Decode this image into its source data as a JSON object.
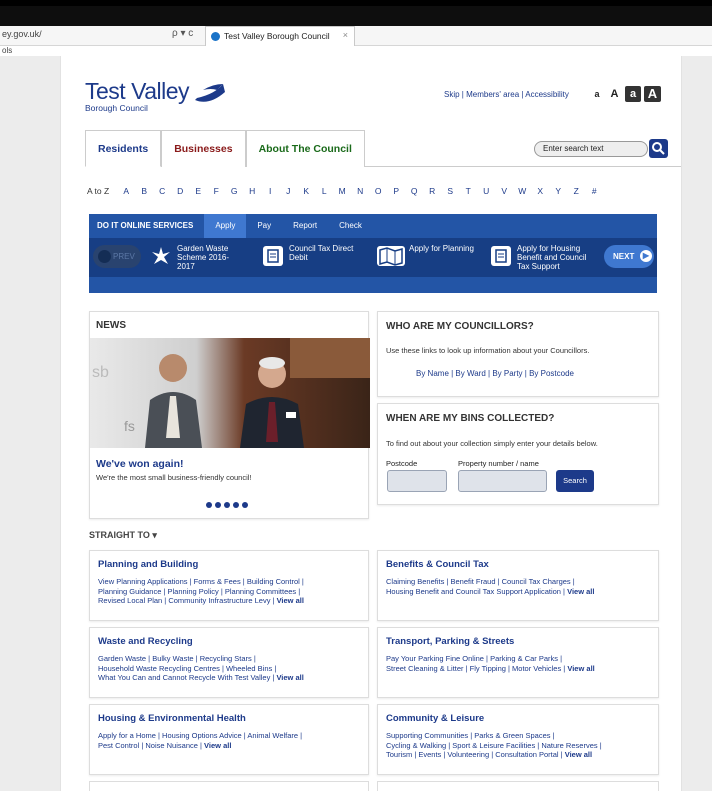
{
  "browser": {
    "url": "ey.gov.uk/",
    "tab_title": "Test Valley Borough Council",
    "tab_close": "×",
    "search_glyph": "ρ ▾ c",
    "tools": "ols"
  },
  "header": {
    "logo_title": "Test Valley",
    "logo_subtitle": "Borough Council",
    "top_links": "Skip | Members' area | Accessibility",
    "text_sizes": [
      "a",
      "A",
      "a",
      "A"
    ]
  },
  "nav": {
    "tabs": [
      "Residents",
      "Businesses",
      "About The Council"
    ],
    "search_placeholder": "Enter search text"
  },
  "az": {
    "label": "A to Z",
    "letters": [
      "A",
      "B",
      "C",
      "D",
      "E",
      "F",
      "G",
      "H",
      "I",
      "J",
      "K",
      "L",
      "M",
      "N",
      "O",
      "P",
      "Q",
      "R",
      "S",
      "T",
      "U",
      "V",
      "W",
      "X",
      "Y",
      "Z",
      "#"
    ]
  },
  "services": {
    "heading": "DO IT ONLINE SERVICES",
    "tabs": [
      "Apply",
      "Pay",
      "Report",
      "Check"
    ],
    "prev": "PREV",
    "next": "NEXT",
    "items": [
      {
        "l1": "Garden Waste",
        "l2": "Scheme 2016-",
        "l3": "2017",
        "icon": "leaf-icon"
      },
      {
        "l1": "Council Tax Direct",
        "l2": "Debit",
        "l3": "",
        "icon": "document-icon"
      },
      {
        "l1": "Apply for Planning",
        "l2": "",
        "l3": "",
        "icon": "map-icon"
      },
      {
        "l1": "Apply for Housing",
        "l2": "Benefit and Council",
        "l3": "Tax Support",
        "icon": "document-icon"
      }
    ]
  },
  "news": {
    "heading": "NEWS",
    "title": "We've won again!",
    "subtitle": "We're the most small business-friendly council!",
    "photo_text": "sb",
    "photo_text2": "fs"
  },
  "councillors": {
    "heading": "WHO ARE MY COUNCILLORS?",
    "description": "Use these links to look up information about your Councillors.",
    "links": "By Name  |  By Ward  |  By Party  |  By Postcode"
  },
  "bins": {
    "heading": "WHEN ARE MY BINS COLLECTED?",
    "description": "To find out about your collection simply enter your details below.",
    "postcode_label": "Postcode",
    "property_label": "Property number / name",
    "search_button": "Search"
  },
  "straight_to": "STRAIGHT TO ▾",
  "sections": {
    "planning": {
      "title": "Planning and Building",
      "lines": [
        "View Planning Applications | Forms & Fees | Building Control |",
        "Planning Guidance | Planning Policy | Planning Committees |",
        "Revised Local Plan | Community Infrastructure Levy | "
      ],
      "view_all": "View all"
    },
    "benefits": {
      "title": "Benefits & Council Tax",
      "lines": [
        "Claiming Benefits | Benefit Fraud | Council Tax Charges |",
        "Housing Benefit and Council Tax Support Application | "
      ],
      "view_all": "View all"
    },
    "waste": {
      "title": "Waste and Recycling",
      "lines": [
        "Garden Waste | Bulky Waste | Recycling Stars |",
        "Household Waste Recycling Centres | Wheeled Bins |",
        "What You Can and Cannot Recycle With Test Valley | "
      ],
      "view_all": "View all"
    },
    "transport": {
      "title": "Transport, Parking & Streets",
      "lines": [
        "Pay Your Parking Fine Online | Parking & Car Parks |",
        "Street Cleaning & Litter | Fly Tipping | Motor Vehicles | "
      ],
      "view_all": "View all"
    },
    "housing": {
      "title": "Housing & Environmental Health",
      "lines": [
        "Apply for a Home | Housing Options Advice | Animal Welfare |",
        "Pest Control | Noise Nuisance | "
      ],
      "view_all": "View all"
    },
    "community": {
      "title": "Community & Leisure",
      "lines": [
        "Supporting Communities | Parks & Green Spaces |",
        "Cycling & Walking | Sport & Leisure Facilities | Nature Reserves |",
        "Tourism | Events | Volunteering | Consultation Portal | "
      ],
      "view_all": "View all"
    }
  }
}
